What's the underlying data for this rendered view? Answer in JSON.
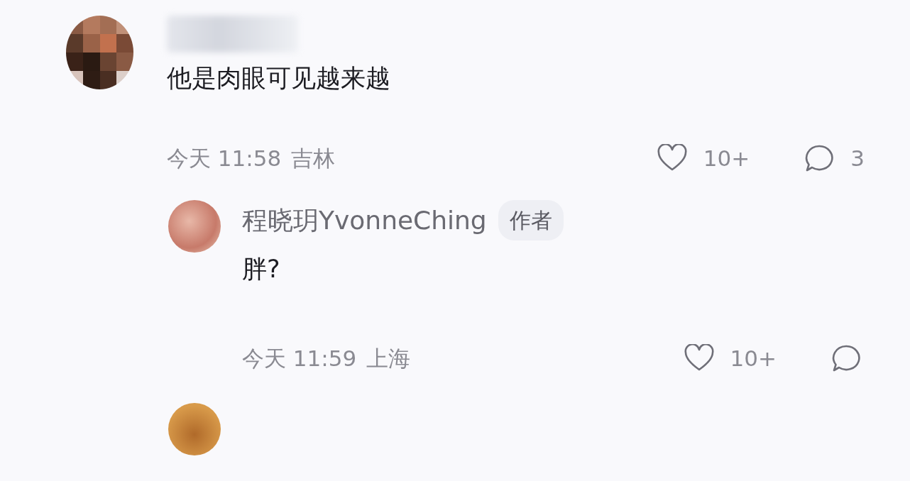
{
  "comments": [
    {
      "text": "他是肉眼可见越来越",
      "time": "今天 11:58",
      "location": "吉林",
      "likes": "10+",
      "reply_count": "3",
      "replies": [
        {
          "author": "程晓玥YvonneChing",
          "badge": "作者",
          "text": "胖?",
          "time": "今天 11:59",
          "location": "上海",
          "likes": "10+"
        }
      ]
    }
  ]
}
